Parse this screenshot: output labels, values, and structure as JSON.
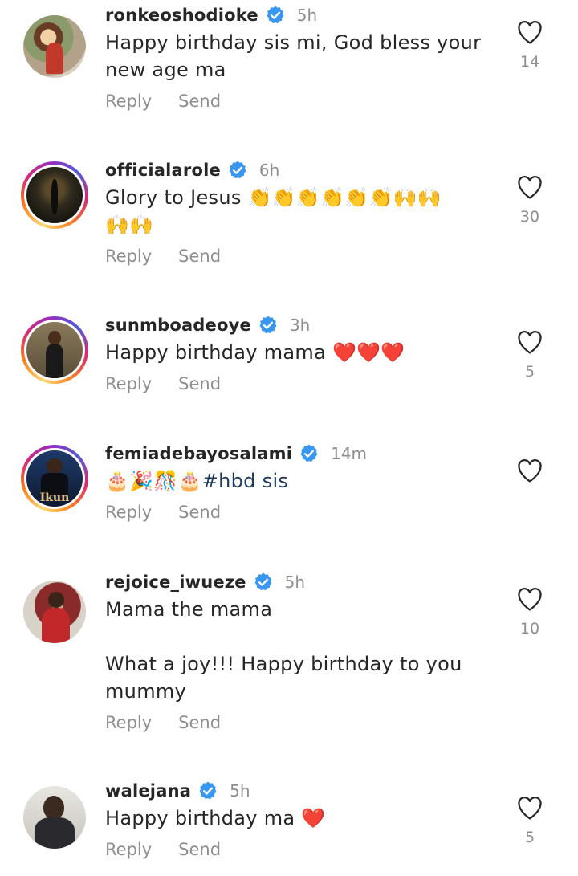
{
  "actions": {
    "reply_label": "Reply",
    "send_label": "Send"
  },
  "colors": {
    "verified": "#3897f0",
    "meta_gray": "#8e8e8e",
    "text": "#262626"
  },
  "comments": [
    {
      "username": "ronkeoshodioke",
      "time": "5h",
      "text": "Happy birthday sis mi, God bless your\nnew age ma",
      "likes": "14"
    },
    {
      "username": "officialarole",
      "time": "6h",
      "text": "Glory to Jesus 👏👏👏👏👏👏🙌🙌\n🙌🙌",
      "likes": "30"
    },
    {
      "username": "sunmboadeoye",
      "time": "3h",
      "text": "Happy birthday mama ❤️❤️❤️",
      "likes": "5"
    },
    {
      "username": "femiadebayosalami",
      "time": "14m",
      "text": "🎂🎉🎊🎂#hbd sis",
      "likes": ""
    },
    {
      "username": "rejoice_iwueze",
      "time": "5h",
      "text": "Mama the mama\n\nWhat a joy!!! Happy birthday to you\nmummy",
      "likes": "10"
    },
    {
      "username": "walejana",
      "time": "5h",
      "text": "Happy birthday ma ❤️",
      "likes": "5"
    }
  ],
  "avatar_overlays": {
    "femiadebayosalami": "Ikun"
  }
}
